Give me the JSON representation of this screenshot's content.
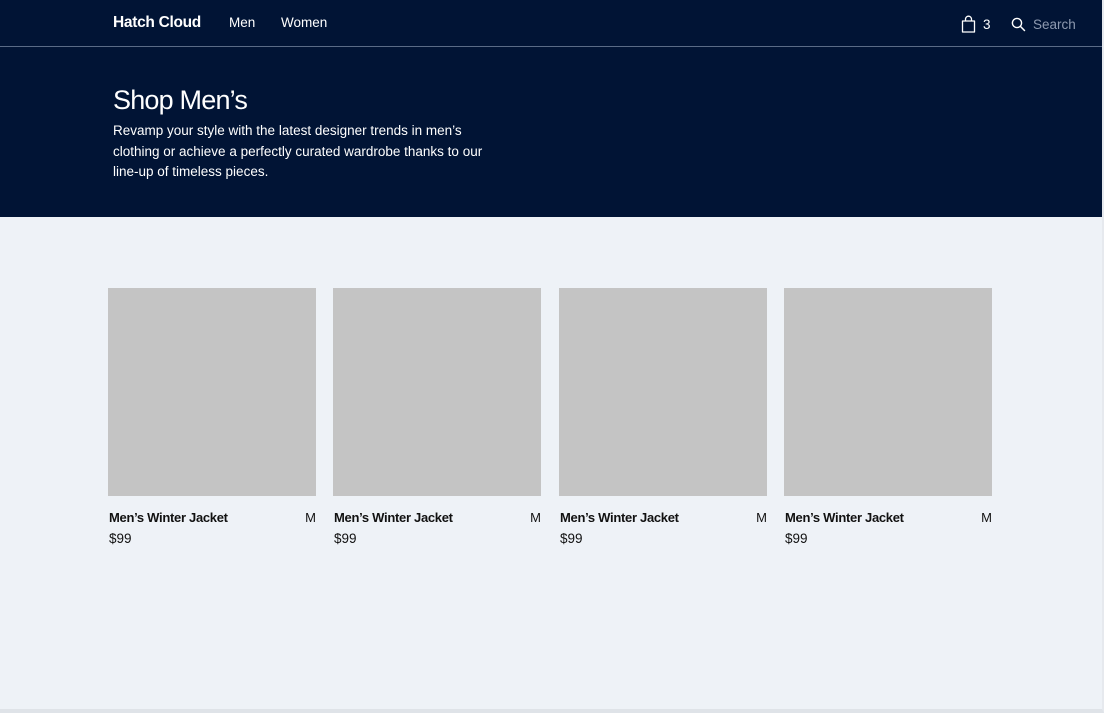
{
  "header": {
    "brand": "Hatch Cloud",
    "nav": [
      {
        "label": "Men"
      },
      {
        "label": "Women"
      }
    ],
    "cart": {
      "icon": "shopping-bag-icon",
      "count": "3"
    },
    "search": {
      "icon": "search-icon",
      "placeholder": "Search"
    }
  },
  "hero": {
    "title": "Shop Men’s",
    "description": "Revamp your style with the latest designer trends in men’s clothing or achieve a perfectly curated wardrobe thanks to our line-up of timeless pieces."
  },
  "products": [
    {
      "name": "Men’s Winter Jacket",
      "size": "M",
      "price": "$99"
    },
    {
      "name": "Men’s Winter Jacket",
      "size": "M",
      "price": "$99"
    },
    {
      "name": "Men’s Winter Jacket",
      "size": "M",
      "price": "$99"
    },
    {
      "name": "Men’s Winter Jacket",
      "size": "M",
      "price": "$99"
    }
  ],
  "colors": {
    "header_bg": "#011435",
    "page_bg": "#eef2f7",
    "image_placeholder": "#c4c4c4"
  }
}
